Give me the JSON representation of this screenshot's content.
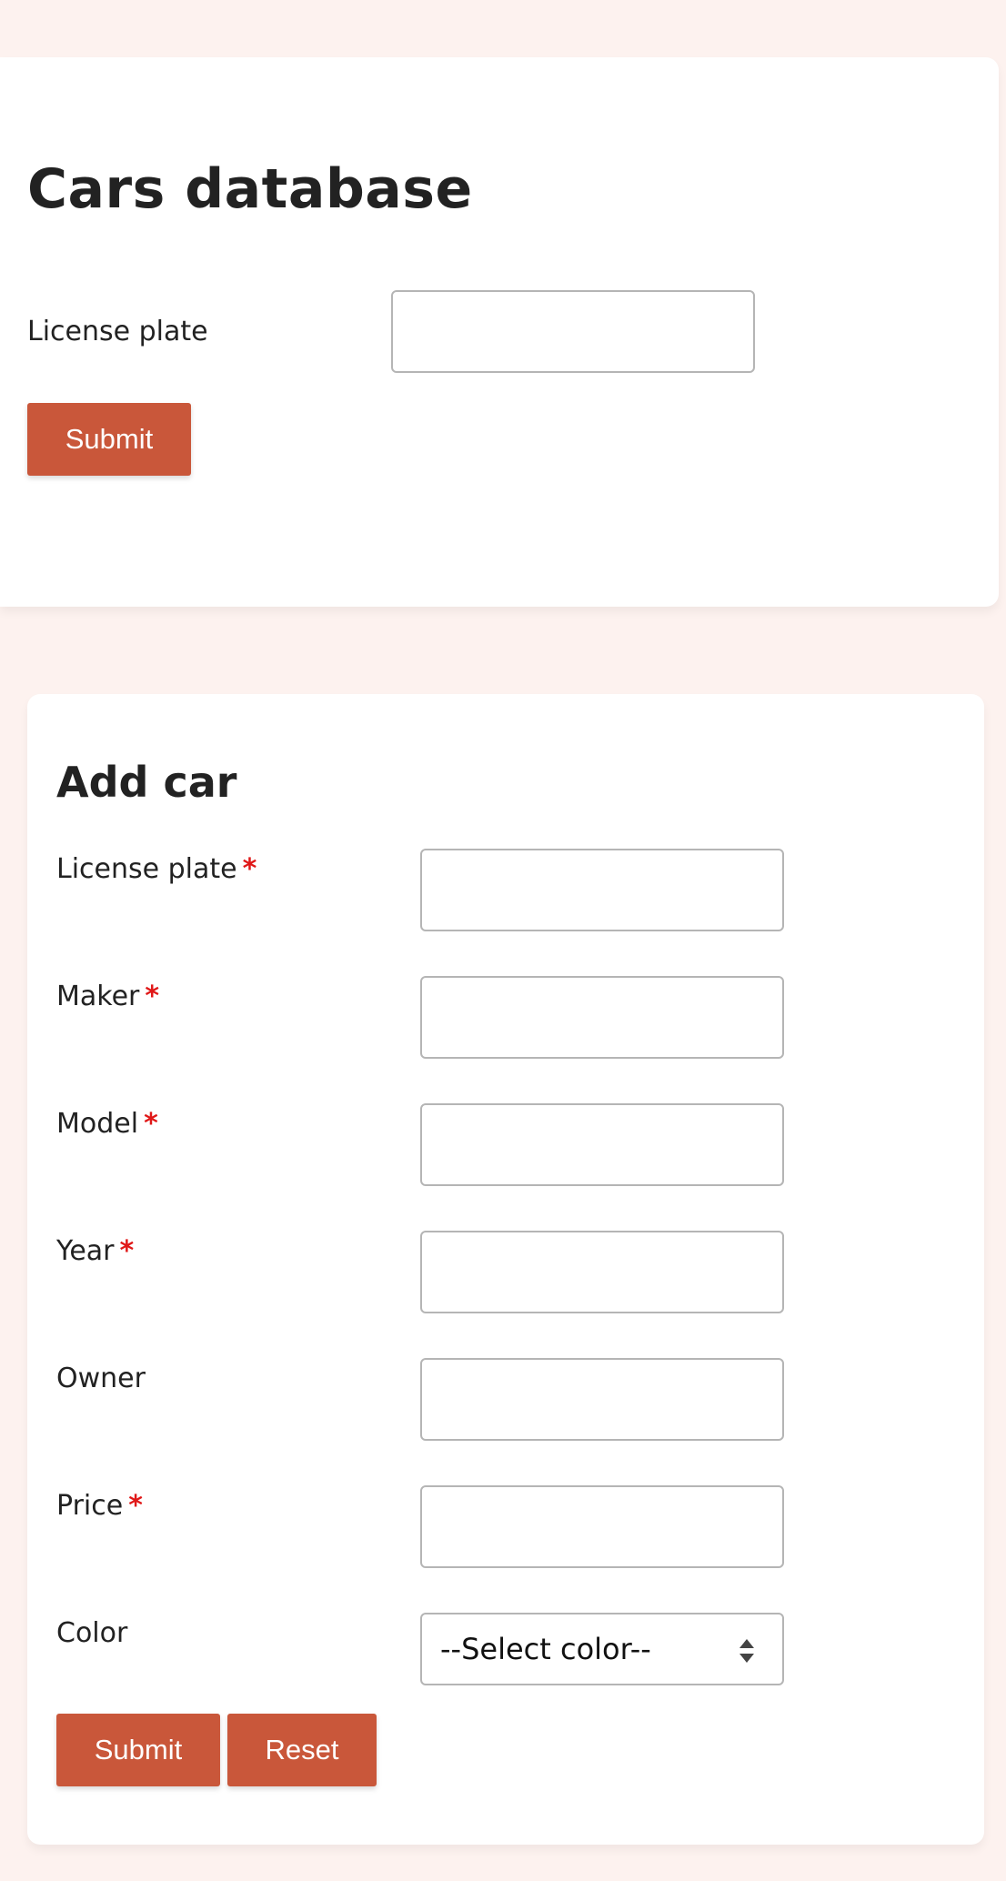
{
  "search": {
    "title": "Cars database",
    "license_plate_label": "License plate",
    "license_plate_value": "",
    "submit_label": "Submit"
  },
  "add_car": {
    "title": "Add car",
    "required_marker": "*",
    "fields": {
      "license_plate": {
        "label": "License plate",
        "value": ""
      },
      "maker": {
        "label": "Maker",
        "value": ""
      },
      "model": {
        "label": "Model",
        "value": ""
      },
      "year": {
        "label": "Year",
        "value": ""
      },
      "owner": {
        "label": "Owner",
        "value": ""
      },
      "price": {
        "label": "Price",
        "value": ""
      },
      "color": {
        "label": "Color",
        "selected": "--Select color--"
      }
    },
    "submit_label": "Submit",
    "reset_label": "Reset"
  },
  "colors": {
    "page_background": "#fdf2ef",
    "card_background": "#ffffff",
    "button": "#c9573a",
    "required": "#e01818"
  }
}
